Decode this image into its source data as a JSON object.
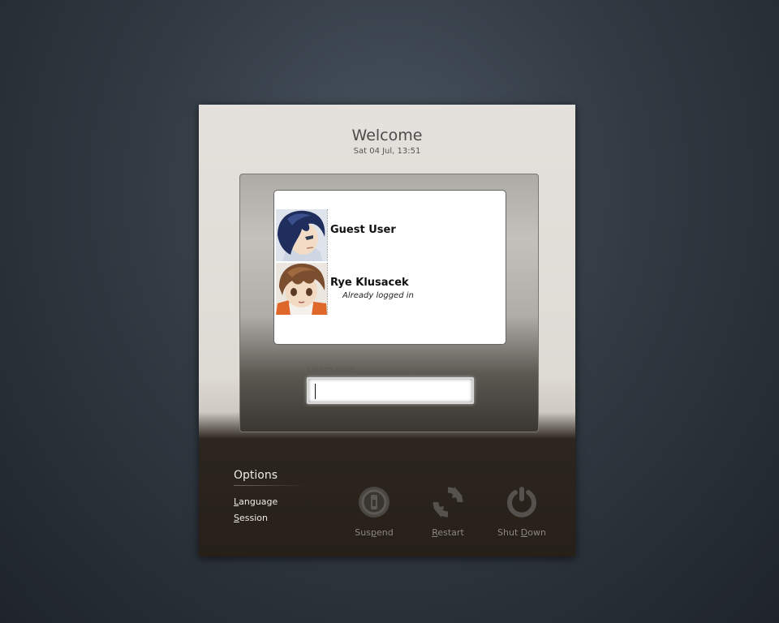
{
  "header": {
    "title": "Welcome",
    "datetime": "Sat 04 Jul, 13:51"
  },
  "users": [
    {
      "name": "Guest User",
      "status": "",
      "avatar": "blue-haired-boy-avatar"
    },
    {
      "name": "Rye Klusacek",
      "status": "Already logged in",
      "avatar": "brown-haired-boy-avatar"
    }
  ],
  "login": {
    "username_label": "Username:",
    "username_value": "",
    "username_placeholder": ""
  },
  "options": {
    "title": "Options",
    "language": {
      "mnemonic": "L",
      "rest": "anguage"
    },
    "session": {
      "mnemonic": "S",
      "rest": "ession"
    }
  },
  "power": {
    "suspend": {
      "pre": "Sus",
      "mnemonic": "p",
      "post": "end",
      "icon": "suspend-icon"
    },
    "restart": {
      "pre": "",
      "mnemonic": "R",
      "post": "estart",
      "icon": "restart-icon"
    },
    "shutdown": {
      "pre": "Shut ",
      "mnemonic": "D",
      "post": "own",
      "icon": "power-icon"
    }
  },
  "colors": {
    "background": "#323a43",
    "panel": "#e4e1dc",
    "footer": "#262019",
    "power_icon": "#55524d"
  }
}
